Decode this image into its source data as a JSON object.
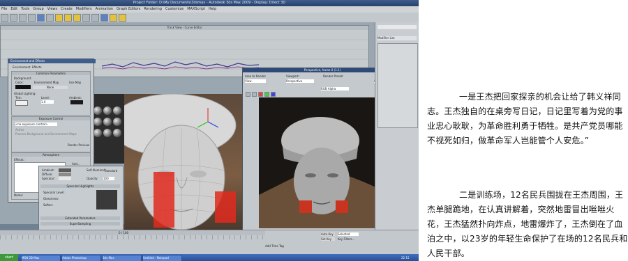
{
  "app": {
    "window_title": "Project Folder: D:\\My Documents\\3dsmax - Autodesk 3ds Max 2009 - Display: Direct 3D",
    "menu": [
      "File",
      "Edit",
      "Tools",
      "Group",
      "Views",
      "Create",
      "Modifiers",
      "Animation",
      "Graph Editors",
      "Rendering",
      "Customize",
      "MAXScript",
      "Help"
    ],
    "curve_editor_title": "Track View - Curve Editor",
    "environment_dialog": {
      "title": "Environment and Effects",
      "tabs": [
        "Environment",
        "Effects"
      ],
      "common_params": "Common Parameters",
      "background": "Background:",
      "color": "Color:",
      "env_map": "Environment Map",
      "use_map": "Use Map",
      "none": "None",
      "global_lighting": "Global Lighting:",
      "tint": "Tint:",
      "level": "Level:",
      "level_value": "1.0",
      "ambient": "Ambient:",
      "exposure_control": "Exposure Control",
      "no_exposure": "<no exposure control>",
      "active": "Active",
      "process_bg": "Process Background and Environment Maps",
      "render_preview": "Render Preview",
      "atmosphere": "Atmosphere",
      "effects": "Effects:",
      "add": "Add...",
      "delete": "Delete",
      "active2": "Active",
      "move_up": "Move Up",
      "move_down": "Move Down",
      "name": "Name:",
      "merge": "Merge"
    },
    "render_dialog": {
      "title": "Perspective, frame 0 (1:1)",
      "area_to_render": "Area to Render",
      "area_value": "View",
      "viewport": "Viewport:",
      "viewport_value": "Perspective",
      "render_preset": "Render Preset:",
      "render_button": "Render",
      "production": "Production",
      "channel": "RGB Alpha"
    },
    "material_editor": {
      "specular_highlights": "Specular Highlights",
      "specular_level": "Specular Level:",
      "glossiness": "Glossiness:",
      "soften": "Soften:",
      "opacity": "Opacity:",
      "opacity_value": "100",
      "extended_parameters": "Extended Parameters",
      "supersampling": "SuperSampling",
      "ambient": "Ambient:",
      "diffuse": "Diffuse:",
      "specular": "Specular:",
      "self_illum": "Self-Illumination",
      "standard": "Standard"
    },
    "command_panel": {
      "modifier_list": "Modifier List"
    },
    "statusbar": {
      "frame": "0 / 100",
      "auto_key": "Auto Key",
      "set_key": "Set Key",
      "selected": "Selected",
      "key_filters": "Key Filters...",
      "add_time_tag": "Add Time Tag"
    },
    "taskbar": {
      "start": "start",
      "tasks": [
        "MSN 3D Max",
        "Adobe Photoshop",
        "3ds Max",
        "Untitled - Notepad"
      ],
      "clock": "22:15"
    }
  },
  "captions": [
    "一是王杰把回家探亲的机会让给了韩义祥同志。王杰独自的在桌旁写日记，日记里写着为党的事业忠心耿耿，为革命胜利勇于牺牲。是共产党员哪能不视死如归，做革命军人岂能管个人安危。”",
    "二是训练场，12名民兵围拢在王杰周围，王杰单腿跪地，在认真讲解着，突然地雷冒出咝咝火花，王杰猛然扑向炸点，地雷爆炸了，王杰倒在了血泊之中，以23岁的年轻生命保护了在场的12名民兵和人民干部。"
  ]
}
